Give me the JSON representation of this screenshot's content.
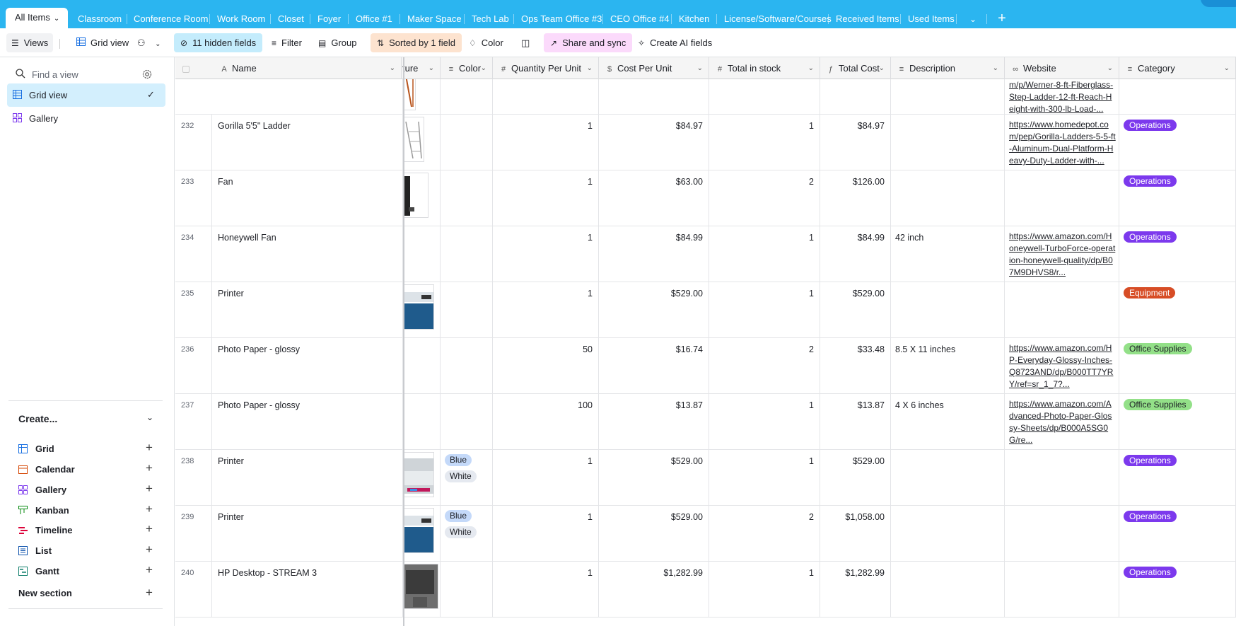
{
  "tabs": {
    "active": "All Items",
    "items": [
      "Classroom",
      "Conference Room",
      "Work Room",
      "Closet",
      "Foyer",
      "Office #1",
      "Maker Space",
      "Tech Lab",
      "Ops Team Office #3",
      "CEO Office #4",
      "Kitchen",
      "License/Software/Courses",
      "Received Items",
      "Used Items"
    ]
  },
  "toolbar": {
    "views": "Views",
    "view_name": "Grid view",
    "hidden_fields": "11 hidden fields",
    "filter": "Filter",
    "group": "Group",
    "sorted": "Sorted by 1 field",
    "color": "Color",
    "share": "Share and sync",
    "ai_fields": "Create AI fields"
  },
  "sidebar": {
    "search_placeholder": "Find a view",
    "views": [
      "Grid view",
      "Gallery"
    ],
    "create_label": "Create...",
    "create_items": [
      "Grid",
      "Calendar",
      "Gallery",
      "Kanban",
      "Timeline",
      "List",
      "Gantt"
    ],
    "new_section": "New section"
  },
  "columns": [
    "Name",
    "ture",
    "Color",
    "Quantity Per Unit",
    "Cost Per Unit",
    "Total in stock",
    "Total Cost",
    "Description",
    "Website",
    "Category"
  ],
  "partial_row": {
    "website": "m/p/Werner-8-ft-Fiberglass-Step-Ladder-12-ft-Reach-Height-with-300-lb-Load-..."
  },
  "rows": [
    {
      "num": "232",
      "name": "Gorilla 5'5\" Ladder",
      "colors": [],
      "qty": "1",
      "cost": "$84.97",
      "stock": "1",
      "total": "$84.97",
      "desc": "",
      "website": "https://www.homedepot.com/pep/Gorilla-Ladders-5-5-ft-Aluminum-Dual-Platform-Heavy-Duty-Ladder-with-...",
      "category": "Operations"
    },
    {
      "num": "233",
      "name": "Fan",
      "colors": [],
      "qty": "1",
      "cost": "$63.00",
      "stock": "2",
      "total": "$126.00",
      "desc": "",
      "website": "",
      "category": "Operations"
    },
    {
      "num": "234",
      "name": "Honeywell Fan",
      "colors": [],
      "qty": "1",
      "cost": "$84.99",
      "stock": "1",
      "total": "$84.99",
      "desc": "42 inch",
      "website": "https://www.amazon.com/Honeywell-TurboForce-operation-honeywell-quality/dp/B07M9DHVS8/r...",
      "category": "Operations"
    },
    {
      "num": "235",
      "name": "Printer",
      "colors": [],
      "qty": "1",
      "cost": "$529.00",
      "stock": "1",
      "total": "$529.00",
      "desc": "",
      "website": "",
      "category": "Equipment"
    },
    {
      "num": "236",
      "name": "Photo Paper - glossy",
      "colors": [],
      "qty": "50",
      "cost": "$16.74",
      "stock": "2",
      "total": "$33.48",
      "desc": "8.5 X 11 inches",
      "website": "https://www.amazon.com/HP-Everyday-Glossy-Inches-Q8723AND/dp/B000TT7YRY/ref=sr_1_7?...",
      "category": "Office Supplies"
    },
    {
      "num": "237",
      "name": "Photo Paper - glossy",
      "colors": [],
      "qty": "100",
      "cost": "$13.87",
      "stock": "1",
      "total": "$13.87",
      "desc": "4 X 6 inches",
      "website": "https://www.amazon.com/Advanced-Photo-Paper-Glossy-Sheets/dp/B000A5SG0G/re...",
      "category": "Office Supplies"
    },
    {
      "num": "238",
      "name": "Printer",
      "colors": [
        "Blue",
        "White"
      ],
      "qty": "1",
      "cost": "$529.00",
      "stock": "1",
      "total": "$529.00",
      "desc": "",
      "website": "",
      "category": "Operations"
    },
    {
      "num": "239",
      "name": "Printer",
      "colors": [
        "Blue",
        "White"
      ],
      "qty": "1",
      "cost": "$529.00",
      "stock": "2",
      "total": "$1,058.00",
      "desc": "",
      "website": "",
      "category": "Operations"
    },
    {
      "num": "240",
      "name": "HP Desktop - STREAM 3",
      "colors": [],
      "qty": "1",
      "cost": "$1,282.99",
      "stock": "1",
      "total": "$1,282.99",
      "desc": "",
      "website": "",
      "category": "Operations"
    }
  ],
  "colors": {
    "brand": "#2bb5f0",
    "Operations": "#7c39ed",
    "Equipment": "#d74d26",
    "Office Supplies": "#93e088",
    "Blue": "#c4d9f9",
    "White": "#e5e9f0"
  }
}
